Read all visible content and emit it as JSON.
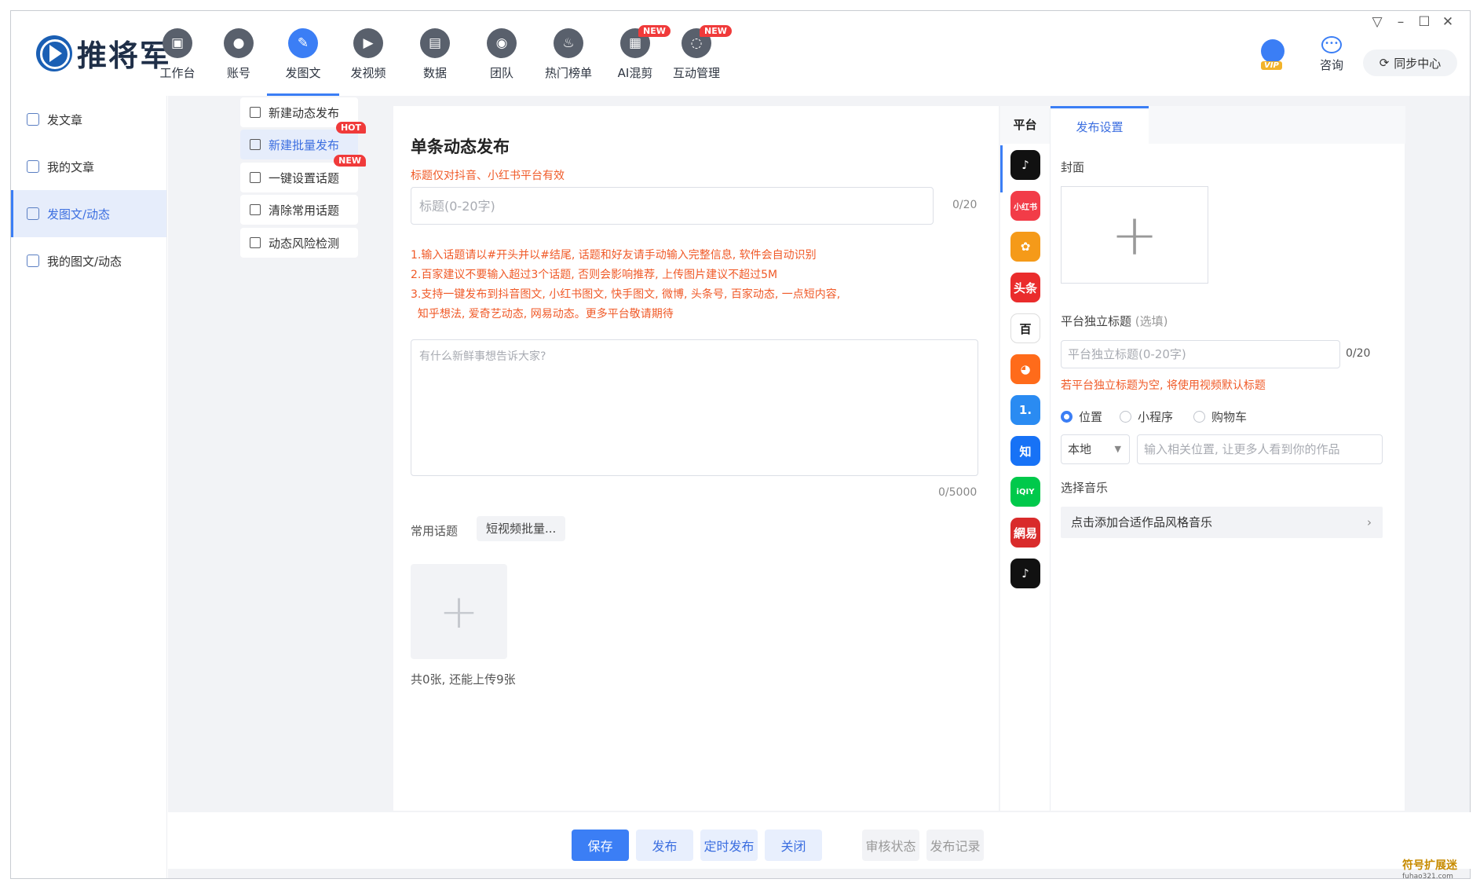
{
  "app": {
    "name": "推将军"
  },
  "nav": [
    {
      "label": "工作台",
      "icon": "monitor-icon",
      "glyph": "▣",
      "new": false
    },
    {
      "label": "账号",
      "icon": "user-icon",
      "glyph": "●",
      "new": false
    },
    {
      "label": "发图文",
      "icon": "feather-icon",
      "glyph": "✎",
      "new": false,
      "active": true
    },
    {
      "label": "发视频",
      "icon": "play-icon",
      "glyph": "▶",
      "new": false
    },
    {
      "label": "数据",
      "icon": "chart-icon",
      "glyph": "▤",
      "new": false
    },
    {
      "label": "团队",
      "icon": "team-icon",
      "glyph": "◉",
      "new": false
    },
    {
      "label": "热门榜单",
      "icon": "fire-icon",
      "glyph": "♨",
      "new": false
    },
    {
      "label": "AI混剪",
      "icon": "toolbox-icon",
      "glyph": "▦",
      "new": true
    },
    {
      "label": "互动管理",
      "icon": "chat-icon",
      "glyph": "◌",
      "new": true
    }
  ],
  "badges": {
    "new": "NEW",
    "hot": "HOT",
    "vip": "VIP"
  },
  "top_right": {
    "consult": "咨询",
    "sync": "同步中心"
  },
  "window_controls": {
    "menu": "▽",
    "minimize": "–",
    "maximize": "☐",
    "close": "✕"
  },
  "sidebar": [
    {
      "label": "发文章",
      "active": false
    },
    {
      "label": "我的文章",
      "active": false
    },
    {
      "label": "发图文/动态",
      "active": true
    },
    {
      "label": "我的图文/动态",
      "active": false
    }
  ],
  "submenu": [
    {
      "label": "新建动态发布",
      "badge": ""
    },
    {
      "label": "新建批量发布",
      "badge": "HOT",
      "active": true
    },
    {
      "label": "一键设置话题",
      "badge": "NEW"
    },
    {
      "label": "清除常用话题",
      "badge": ""
    },
    {
      "label": "动态风险检测",
      "badge": ""
    }
  ],
  "editor": {
    "heading": "单条动态发布",
    "title_note": "标题仅对抖音、小红书平台有效",
    "title_placeholder": "标题(0-20字)",
    "title_count": "0/20",
    "rules": [
      "1.输入话题请以#开头并以#结尾, 话题和好友请手动输入完整信息, 软件会自动识别",
      "2.百家建议不要输入超过3个话题, 否则会影响推荐, 上传图片建议不超过5M",
      "3.支持一键发布到抖音图文, 小红书图文, 快手图文, 微博, 头条号, 百家动态, 一点短内容,",
      "  知乎想法, 爱奇艺动态, 网易动态。更多平台敬请期待"
    ],
    "content_placeholder": "有什么新鲜事想告诉大家?",
    "content_count": "0/5000",
    "topic_label": "常用话题",
    "topic_chip": "短视频批量...",
    "upload_plus": "+",
    "upload_note": "共0张, 还能上传9张"
  },
  "platform": {
    "header": "平台",
    "items": [
      {
        "name": "douyin",
        "glyph": "♪",
        "color": "#111111"
      },
      {
        "name": "xiaohongshu",
        "glyph": "小红书",
        "color": "#f23c48"
      },
      {
        "name": "kuaishou",
        "glyph": "✿",
        "color": "#f59a19"
      },
      {
        "name": "toutiao",
        "glyph": "头条",
        "color": "#ea2c2c"
      },
      {
        "name": "baijia",
        "glyph": "百",
        "color": "#ffffff"
      },
      {
        "name": "weibo",
        "glyph": "◕",
        "color": "#ff6b1a"
      },
      {
        "name": "yidian",
        "glyph": "1.",
        "color": "#2a8bf2"
      },
      {
        "name": "zhihu",
        "glyph": "知",
        "color": "#1772f6"
      },
      {
        "name": "iqiyi",
        "glyph": "iQIY",
        "color": "#00c94b"
      },
      {
        "name": "wangyi",
        "glyph": "網易",
        "color": "#d92b2b"
      },
      {
        "name": "douyin-alt",
        "glyph": "♪",
        "color": "#111111"
      }
    ]
  },
  "settings": {
    "tab": "发布设置",
    "cover_label": "封面",
    "cover_plus": "+",
    "ind_title_label": "平台独立标题",
    "ind_title_optional": "(选填)",
    "ind_title_placeholder": "平台独立标题(0-20字)",
    "ind_title_count": "0/20",
    "ind_title_note": "若平台独立标题为空, 将使用视频默认标题",
    "radios": [
      {
        "label": "位置",
        "on": true
      },
      {
        "label": "小程序",
        "on": false
      },
      {
        "label": "购物车",
        "on": false
      }
    ],
    "location_select": "本地",
    "location_placeholder": "输入相关位置, 让更多人看到你的作品",
    "music_label": "选择音乐",
    "music_row": "点击添加合适作品风格音乐"
  },
  "bottom": {
    "save": "保存",
    "publish": "发布",
    "schedule": "定时发布",
    "close": "关闭",
    "review": "审核状态",
    "records": "发布记录"
  },
  "watermark": {
    "main": "符号扩展迷",
    "sub": "fuhao321.com"
  }
}
